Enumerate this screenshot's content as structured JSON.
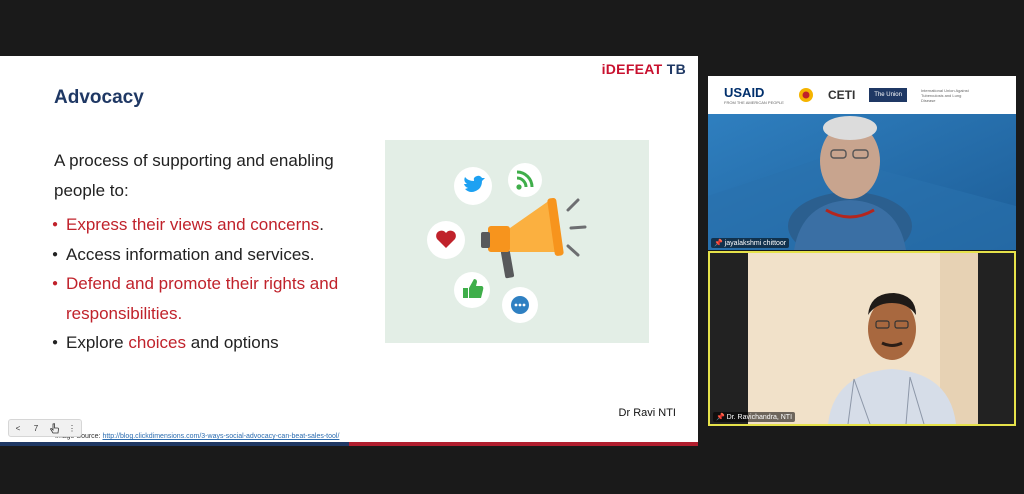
{
  "slide": {
    "brand_prefix": "iDEFEAT",
    "brand_suffix": "TB",
    "title": "Advocacy",
    "intro": "A process of supporting and enabling people to:",
    "bullets": [
      {
        "text": "Express their views and concerns",
        "suffix": "."
      },
      {
        "text": "Access information and services."
      },
      {
        "text": "Defend and promote their rights and responsibilities."
      },
      {
        "prefix": "Explore ",
        "highlight": "choices",
        "suffix": " and options"
      }
    ],
    "credit": "Dr Ravi NTI",
    "image_source_label": "Image Source: ",
    "image_source_url": "http://blog.clickdimensions.com/3-ways-social-advocacy-can-beat-sales-tool/"
  },
  "slide_nav": {
    "prev": "<",
    "page": "7",
    "pointer": "pointer-icon",
    "more": "⋮"
  },
  "participants": [
    {
      "name": "jayalakshmi chittoor"
    },
    {
      "name": "Dr. Ravichandra, NTI"
    }
  ],
  "banner_logos": {
    "usaid": "USAID",
    "usaid_tagline": "FROM THE AMERICAN PEOPLE",
    "ceti": "CETI",
    "union": "The Union",
    "union_tagline": "International Union Against Tuberculosis and Lung Disease"
  },
  "colors": {
    "navy": "#1f3864",
    "red": "#c0222b",
    "tile_highlight": "#e6e24a"
  }
}
